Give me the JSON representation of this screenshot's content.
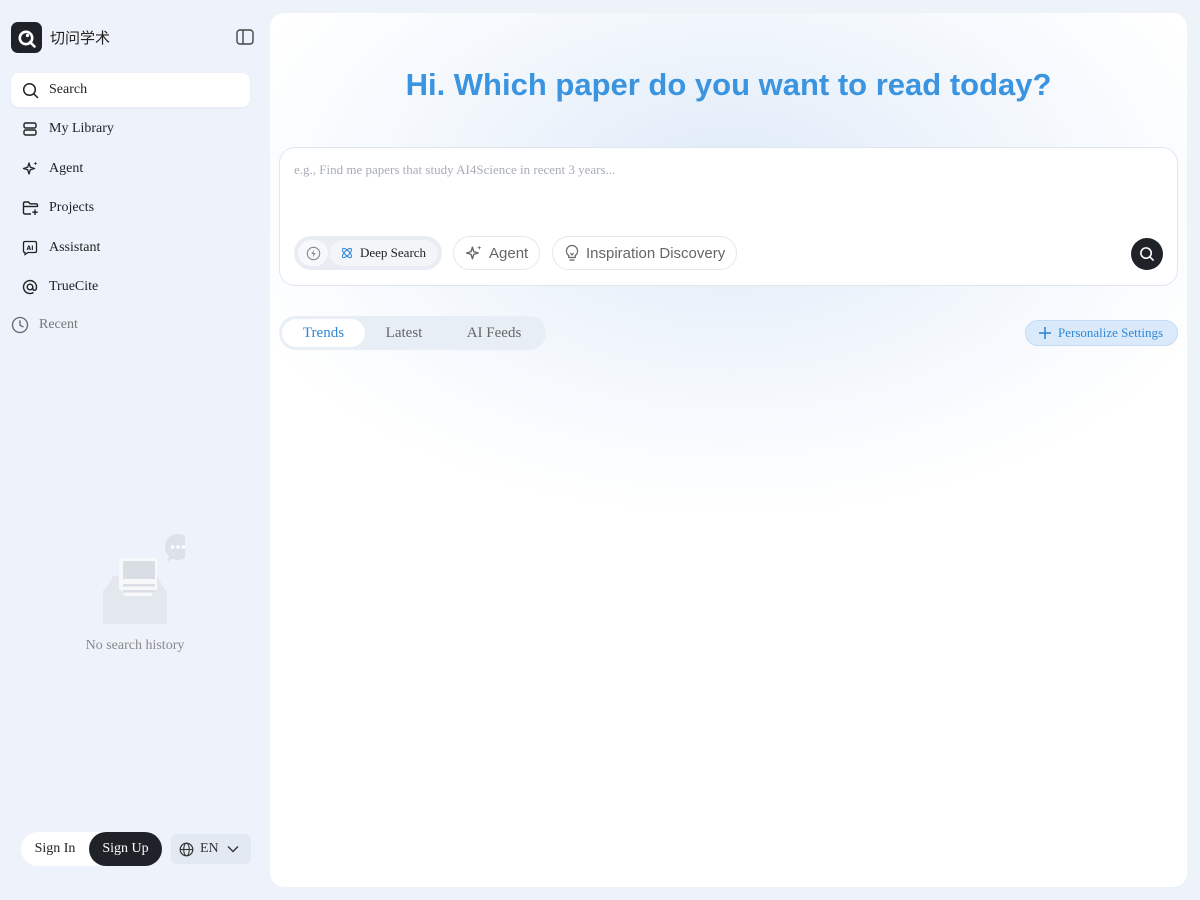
{
  "brand": {
    "name": "切问学术",
    "icon": "q-logo-icon"
  },
  "sidebar": {
    "nav": [
      {
        "label": "Search",
        "icon": "search-icon",
        "active": true
      },
      {
        "label": "My Library",
        "icon": "library-icon"
      },
      {
        "label": "Agent",
        "icon": "sparkle-icon"
      },
      {
        "label": "Projects",
        "icon": "folder-plus-icon"
      },
      {
        "label": "Assistant",
        "icon": "ai-badge-icon"
      },
      {
        "label": "TrueCite",
        "icon": "at-icon"
      }
    ],
    "recent_label": "Recent",
    "empty_text": "No search history",
    "sign_in": "Sign In",
    "sign_up": "Sign Up",
    "language": "EN"
  },
  "main": {
    "headline": "Hi. Which paper do you want to read today?",
    "search": {
      "placeholder": "e.g., Find me papers that study AI4Science in recent 3 years...",
      "value": "",
      "mode_label": "Deep Search",
      "chips": [
        {
          "label": "Agent",
          "icon": "sparkle-icon"
        },
        {
          "label": "Inspiration Discovery",
          "icon": "lightbulb-icon"
        }
      ]
    },
    "tabs": [
      {
        "label": "Trends",
        "active": true
      },
      {
        "label": "Latest"
      },
      {
        "label": "AI Feeds"
      }
    ],
    "personalize_label": "Personalize Settings"
  },
  "colors": {
    "accent": "#3a94e0",
    "dark": "#1f2329",
    "sidebar_bg": "#eef3fb"
  }
}
